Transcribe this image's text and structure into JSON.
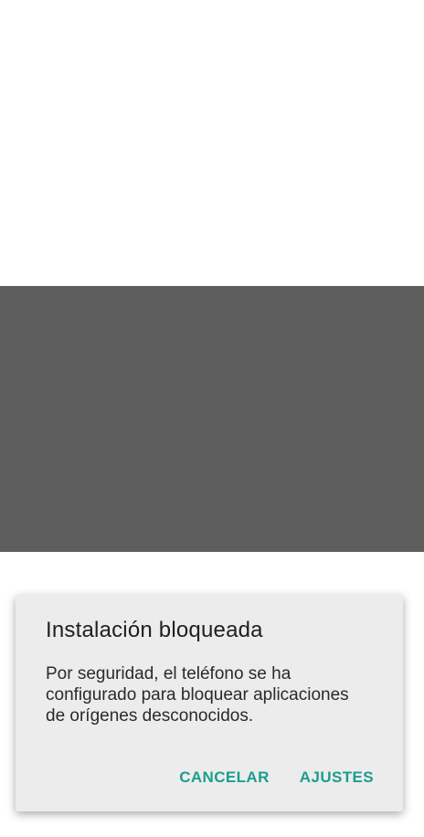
{
  "dialog": {
    "title": "Instalación bloqueada",
    "message": "Por seguridad, el teléfono se ha configurado para bloquear aplicaciones de orígenes desconocidos.",
    "buttons": {
      "cancel_label": "CANCELAR",
      "settings_label": "AJUSTES"
    }
  },
  "colors": {
    "accent": "#1a9e8c",
    "scrim": "#5e5e5e",
    "dialog_background": "#ececec"
  }
}
